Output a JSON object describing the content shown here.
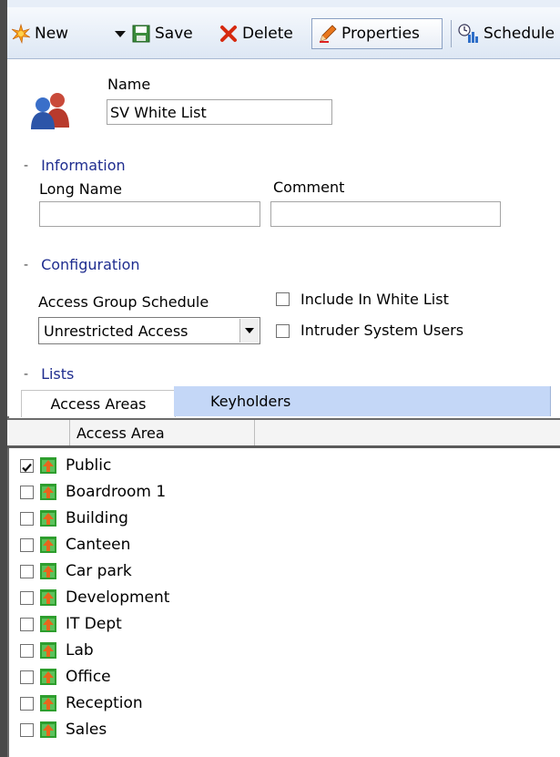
{
  "toolbar": {
    "new_label": "New",
    "save_label": "Save",
    "delete_label": "Delete",
    "properties_label": "Properties",
    "schedule_label": "Schedule"
  },
  "form": {
    "name_label": "Name",
    "name_value": "SV White List",
    "information_section": "Information",
    "long_name_label": "Long Name",
    "long_name_value": "",
    "comment_label": "Comment",
    "comment_value": "",
    "configuration_section": "Configuration",
    "access_group_schedule_label": "Access Group Schedule",
    "access_group_schedule_value": "Unrestricted Access",
    "include_white_list_label": "Include In White List",
    "include_white_list_checked": false,
    "intruder_users_label": "Intruder System Users",
    "intruder_users_checked": false,
    "lists_section": "Lists"
  },
  "tabs": [
    {
      "label": "Access Areas",
      "active": true
    },
    {
      "label": "Keyholders",
      "active": false
    }
  ],
  "grid": {
    "column_header": "Access Area",
    "rows": [
      {
        "name": "Public",
        "checked": true
      },
      {
        "name": "Boardroom 1",
        "checked": false
      },
      {
        "name": "Building",
        "checked": false
      },
      {
        "name": "Canteen",
        "checked": false
      },
      {
        "name": "Car park",
        "checked": false
      },
      {
        "name": "Development",
        "checked": false
      },
      {
        "name": "IT Dept",
        "checked": false
      },
      {
        "name": "Lab",
        "checked": false
      },
      {
        "name": "Office",
        "checked": false
      },
      {
        "name": "Reception",
        "checked": false
      },
      {
        "name": "Sales",
        "checked": false
      }
    ]
  },
  "colors": {
    "toolbar_bg": "#dde7f4",
    "section_text": "#1f2d8f",
    "inactive_tab": "#c4d7f7",
    "area_icon_green": "#2e9e2e",
    "area_icon_orange": "#e8661c"
  },
  "icons": [
    "new-icon",
    "save-icon",
    "delete-icon",
    "properties-icon",
    "schedule-icon",
    "user-group-icon",
    "access-area-icon",
    "checkmark-icon",
    "dropdown-arrow-icon"
  ]
}
